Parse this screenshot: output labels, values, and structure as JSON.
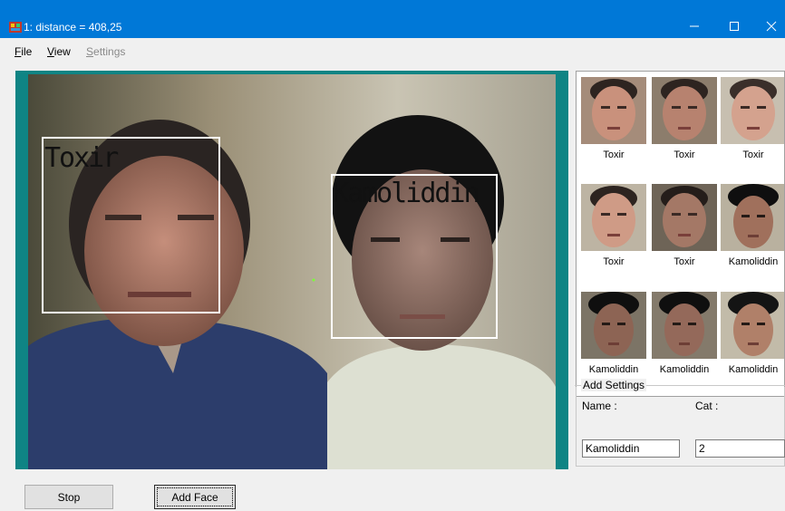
{
  "window": {
    "title": "1: distance = 408,25",
    "icon": "app-icon"
  },
  "menu": [
    {
      "label": "File",
      "accel": "F",
      "rest": "ile",
      "enabled": true
    },
    {
      "label": "View",
      "accel": "V",
      "rest": "iew",
      "enabled": true
    },
    {
      "label": "Settings",
      "accel": "S",
      "rest": "ettings",
      "enabled": false
    }
  ],
  "video": {
    "detections": [
      {
        "name": "Toxir"
      },
      {
        "name": "Kamoliddin"
      }
    ]
  },
  "gallery": [
    {
      "name": "Toxir"
    },
    {
      "name": "Toxir"
    },
    {
      "name": "Toxir"
    },
    {
      "name": "Toxir"
    },
    {
      "name": "Toxir"
    },
    {
      "name": "Kamoliddin"
    },
    {
      "name": "Kamoliddin"
    },
    {
      "name": "Kamoliddin"
    },
    {
      "name": "Kamoliddin"
    }
  ],
  "add_settings": {
    "legend": "Add Settings",
    "name_label": "Name :",
    "name_value": "Kamoliddin",
    "cat_label": "Cat :",
    "cat_value": "2"
  },
  "buttons": {
    "stop": "Stop",
    "add_face": "Add Face"
  },
  "colors": {
    "titlebar": "#0078d7",
    "video_bg": "#0f8484",
    "face_box": "#ffffff"
  }
}
